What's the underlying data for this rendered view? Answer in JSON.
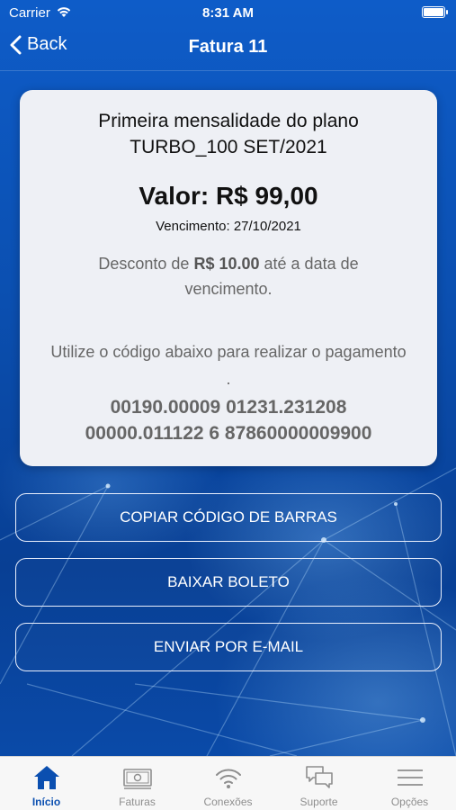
{
  "status_bar": {
    "carrier": "Carrier",
    "time": "8:31 AM"
  },
  "nav": {
    "back_label": "Back",
    "title": "Fatura 11"
  },
  "invoice": {
    "description_line1": "Primeira mensalidade do plano",
    "description_line2": "TURBO_100 SET/2021",
    "valor": "Valor: R$ 99,00",
    "vencimento": "Vencimento: 27/10/2021",
    "desconto_prefix": "Desconto de ",
    "desconto_amount": "R$ 10.00",
    "desconto_suffix": " até a data de vencimento.",
    "instruction": "Utilize o código abaixo para realizar o pagamento .",
    "barcode_line1": "00190.00009 01231.231208",
    "barcode_line2": "00000.011122 6 87860000009900"
  },
  "buttons": {
    "copy_label": "COPIAR CÓDIGO DE BARRAS",
    "download_label": "BAIXAR BOLETO",
    "email_label": "ENVIAR POR E-MAIL"
  },
  "tabs": [
    {
      "label": "Início",
      "icon": "home-icon",
      "active": true
    },
    {
      "label": "Faturas",
      "icon": "bill-icon",
      "active": false
    },
    {
      "label": "Conexões",
      "icon": "wifi-icon",
      "active": false
    },
    {
      "label": "Suporte",
      "icon": "chat-icon",
      "active": false
    },
    {
      "label": "Opções",
      "icon": "menu-icon",
      "active": false
    }
  ],
  "colors": {
    "accent": "#0b4fb0",
    "tab_inactive": "#8e8e8e",
    "card_bg": "#eef0f5"
  }
}
